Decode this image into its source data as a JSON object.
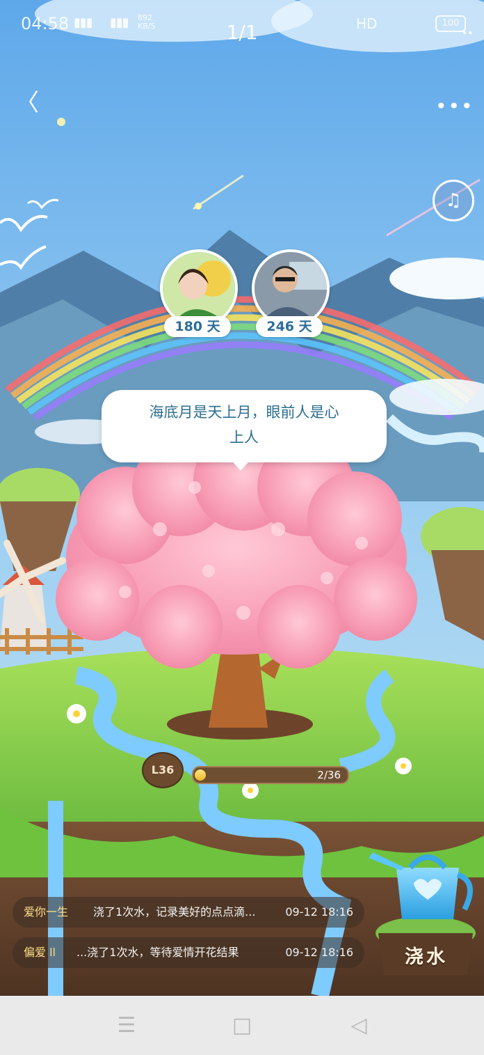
{
  "status_bar": {
    "time": "04:58",
    "signal_1": "4G",
    "signal_2": "4G",
    "net_speed_value": "892",
    "net_speed_unit": "KB/S",
    "hd_label": "HD",
    "battery": "100"
  },
  "header": {
    "page_counter": "1/1"
  },
  "couple": {
    "left": {
      "days": "180 天"
    },
    "right": {
      "days": "246 天"
    }
  },
  "bubble": {
    "line1": "海底月是天上月，眼前人是心",
    "line2": "上人"
  },
  "tree": {
    "level": "L36",
    "progress_text": "2/36",
    "progress_fraction": 0.056
  },
  "log": [
    {
      "user": "爱你一生",
      "action": "浇了1次水，记录美好的点点滴...",
      "time": "09-12 18:16"
    },
    {
      "user": "偏爱 ll",
      "action": "...浇了1次水，等待爱情开花结果",
      "time": "09-12 18:16"
    }
  ],
  "actions": {
    "water_label": "浇水"
  },
  "colors": {
    "sky": "#8cc4f0",
    "blossom": "#f7a3b8",
    "grass": "#8fd14a",
    "accent_text": "#2b6e8e"
  },
  "icons": [
    "back-icon",
    "more-icon",
    "music-icon",
    "watering-can-icon",
    "menu-icon",
    "home-icon",
    "back-nav-icon"
  ]
}
